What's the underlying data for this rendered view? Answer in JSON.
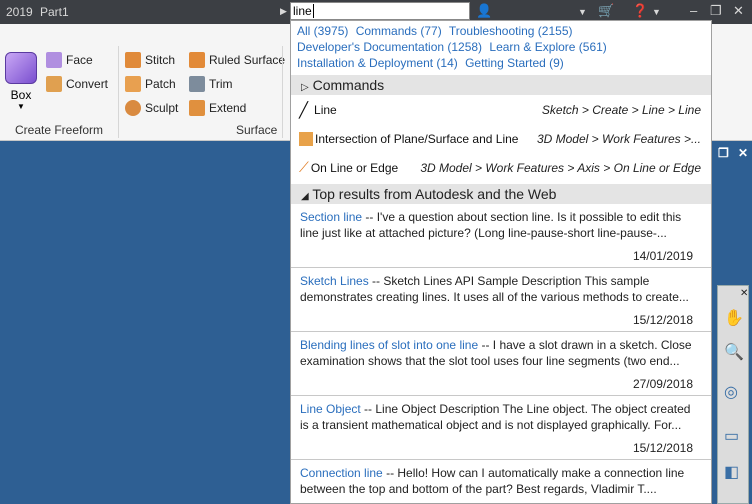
{
  "titlebar": {
    "year": "2019",
    "doc": "Part1",
    "search_value": "line"
  },
  "ribbon": {
    "freeform": {
      "box": "Box",
      "face": "Face",
      "convert": "Convert",
      "panel": "Create Freeform"
    },
    "surface": {
      "stitch": "Stitch",
      "patch": "Patch",
      "sculpt": "Sculpt",
      "ruled": "Ruled Surface",
      "trim": "Trim",
      "extend": "Extend",
      "panel": "Surface"
    }
  },
  "search_results": {
    "categories": [
      "All (3975)",
      "Commands (77)",
      "Troubleshooting (2155)",
      "Developer's Documentation (1258)",
      "Learn & Explore (561)",
      "Installation & Deployment (14)",
      "Getting Started (9)"
    ],
    "commands_header": "Commands",
    "commands": [
      {
        "label": "Line",
        "path": "Sketch > Create > Line > Line"
      },
      {
        "label": "Intersection of Plane/Surface and Line",
        "path": "3D Model > Work Features >..."
      },
      {
        "label": "On Line or Edge",
        "path": "3D Model > Work Features > Axis > On Line or Edge"
      }
    ],
    "web_header": "Top results from Autodesk and the Web",
    "results": [
      {
        "title": "Section line",
        "text": " -- I've a question about section line. Is it possible to edit this line just like at attached picture? (Long line-pause-short line-pause-...",
        "date": "14/01/2019"
      },
      {
        "title": "Sketch Lines",
        "text": " -- Sketch Lines API Sample Description This sample demonstrates creating lines. It uses all of the various methods to create...",
        "date": "15/12/2018"
      },
      {
        "title": "Blending lines of slot into one line",
        "text": " -- I have a slot drawn in a sketch. Close examination shows that the slot tool uses four line segments (two end...",
        "date": "27/09/2018"
      },
      {
        "title": "Line Object",
        "text": " -- Line Object Description The Line object. The object created is a transient mathematical object and is not displayed graphically. For...",
        "date": "15/12/2018"
      },
      {
        "title": "Connection line",
        "text": " -- Hello! How can I automatically make a connection line between the top and bottom of the part? Best regards, Vladimir T....",
        "date": ""
      }
    ]
  },
  "colors": {
    "link": "#2a6ebd",
    "canvas": "#2e5f93",
    "titlebar": "#3c3f44"
  }
}
